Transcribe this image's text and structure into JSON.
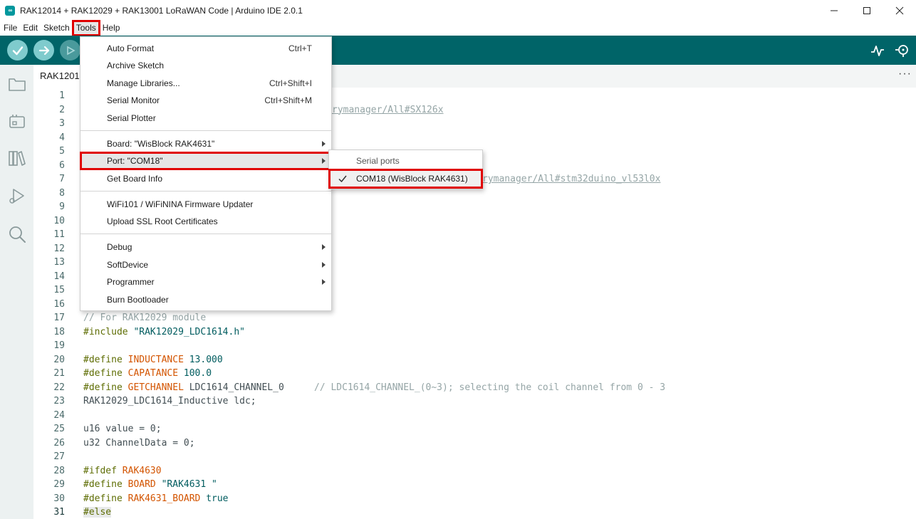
{
  "window": {
    "title": "RAK12014 + RAK12029 + RAK13001 LoRaWAN Code | Arduino IDE 2.0.1",
    "app_icon_text": "∞"
  },
  "menubar": {
    "items": [
      "File",
      "Edit",
      "Sketch",
      "Tools",
      "Help"
    ]
  },
  "tab": {
    "label": "RAK1201"
  },
  "tools_menu": {
    "auto_format": {
      "label": "Auto Format",
      "shortcut": "Ctrl+T"
    },
    "archive_sketch": {
      "label": "Archive Sketch"
    },
    "manage_libraries": {
      "label": "Manage Libraries...",
      "shortcut": "Ctrl+Shift+I"
    },
    "serial_monitor": {
      "label": "Serial Monitor",
      "shortcut": "Ctrl+Shift+M"
    },
    "serial_plotter": {
      "label": "Serial Plotter"
    },
    "board": {
      "label": "Board: \"WisBlock RAK4631\""
    },
    "port": {
      "label": "Port: \"COM18\""
    },
    "get_board_info": {
      "label": "Get Board Info"
    },
    "wifi_updater": {
      "label": "WiFi101 / WiFiNINA Firmware Updater"
    },
    "upload_ssl": {
      "label": "Upload SSL Root Certificates"
    },
    "debug": {
      "label": "Debug"
    },
    "softdevice": {
      "label": "SoftDevice"
    },
    "programmer": {
      "label": "Programmer"
    },
    "burn_bootloader": {
      "label": "Burn Bootloader"
    }
  },
  "port_submenu": {
    "header": "Serial ports",
    "selected_port": "COM18 (WisBlock RAK4631)"
  },
  "editor": {
    "line_numbers": [
      "1",
      "2",
      "3",
      "4",
      "5",
      "6",
      "7",
      "8",
      "9",
      "10",
      "11",
      "12",
      "13",
      "14",
      "15",
      "16",
      "17",
      "18",
      "19",
      "20",
      "21",
      "22",
      "23",
      "24",
      "25",
      "26",
      "27",
      "28",
      "29",
      "30",
      "31"
    ],
    "line2_link": "rymanager/All#SX126x",
    "line7_link": "rymanager/All#stm32duino_vl53l0x",
    "line17_comment": "// For RAK12029 module",
    "line18_kw": "#include",
    "line18_str": "\"RAK12029_LDC1614.h\"",
    "line20_kw": "#define",
    "line20_ident": "INDUCTANCE",
    "line20_val": "13.000",
    "line21_kw": "#define",
    "line21_ident": "CAPATANCE",
    "line21_val": "100.0",
    "line22_kw": "#define",
    "line22_ident": "GETCHANNEL",
    "line22_val": "LDC1614_CHANNEL_0",
    "line22_comment": "// LDC1614_CHANNEL_(0~3); selecting the coil channel from 0 - 3",
    "line23_text": "RAK12029_LDC1614_Inductive ldc;",
    "line25_text": "u16 value = 0;",
    "line26_text": "u32 ChannelData = 0;",
    "line28_kw": "#ifdef",
    "line28_ident": "RAK4630",
    "line29_kw": "#define",
    "line29_ident": "BOARD",
    "line29_str": "\"RAK4631 \"",
    "line30_kw": "#define",
    "line30_ident": "RAK4631_BOARD",
    "line30_val": "true",
    "line31_kw": "#else"
  },
  "colors": {
    "toolbar_bg": "#006468",
    "accent": "#00979d",
    "highlight_box": "#e00000"
  }
}
